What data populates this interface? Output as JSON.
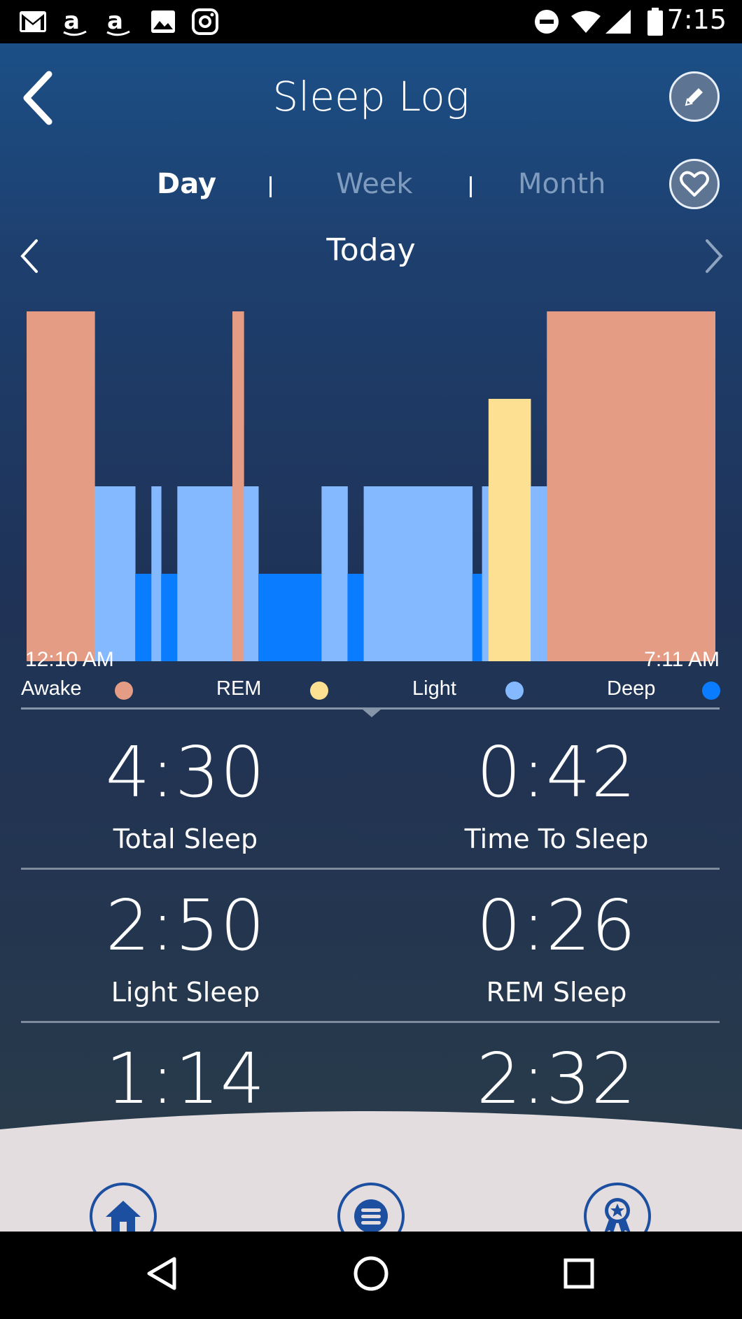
{
  "status_bar": {
    "time": "7:15",
    "left_icons": [
      "gmail-icon",
      "amazon-icon",
      "amazon-icon",
      "photo-icon",
      "instagram-icon"
    ],
    "right_icons": [
      "do-not-disturb-icon",
      "wifi-icon",
      "signal-icon",
      "battery-icon"
    ]
  },
  "header": {
    "title": "Sleep Log",
    "back_icon": "chevron-left-icon",
    "edit_icon": "pencil-icon",
    "favorite_icon": "heart-icon"
  },
  "tabs": [
    {
      "label": "Day",
      "active": true
    },
    {
      "label": "Week",
      "active": false
    },
    {
      "label": "Month",
      "active": false
    }
  ],
  "date_nav": {
    "label": "Today",
    "prev_icon": "chevron-left-icon",
    "next_icon": "chevron-right-icon"
  },
  "chart_data": {
    "type": "bar",
    "start_time": "12:10 AM",
    "end_time": "7:11 AM",
    "levels": [
      "Deep",
      "Light",
      "REM",
      "Awake"
    ],
    "colors": {
      "Awake": "#e59c84",
      "REM": "#fde092",
      "Light": "#85b9ff",
      "Deep": "#0a7cff"
    },
    "segments": [
      {
        "stage": "Awake",
        "minutes": 42
      },
      {
        "stage": "Light",
        "minutes": 25
      },
      {
        "stage": "Deep",
        "minutes": 10
      },
      {
        "stage": "Light",
        "minutes": 6
      },
      {
        "stage": "Deep",
        "minutes": 10
      },
      {
        "stage": "Light",
        "minutes": 34
      },
      {
        "stage": "Awake",
        "minutes": 7
      },
      {
        "stage": "Light",
        "minutes": 9
      },
      {
        "stage": "Deep",
        "minutes": 39
      },
      {
        "stage": "Light",
        "minutes": 16
      },
      {
        "stage": "Deep",
        "minutes": 10
      },
      {
        "stage": "Light",
        "minutes": 67
      },
      {
        "stage": "Deep",
        "minutes": 6
      },
      {
        "stage": "Light",
        "minutes": 4
      },
      {
        "stage": "REM",
        "minutes": 26
      },
      {
        "stage": "Light",
        "minutes": 10
      },
      {
        "stage": "Awake",
        "minutes": 104
      }
    ]
  },
  "legend": [
    {
      "label": "Awake",
      "color": "#e59c84"
    },
    {
      "label": "REM",
      "color": "#fde092"
    },
    {
      "label": "Light",
      "color": "#85b9ff"
    },
    {
      "label": "Deep",
      "color": "#0a7cff"
    }
  ],
  "stats": [
    {
      "value": "4:30",
      "label": "Total Sleep"
    },
    {
      "value": "0:42",
      "label": "Time To Sleep"
    },
    {
      "value": "2:50",
      "label": "Light Sleep"
    },
    {
      "value": "0:26",
      "label": "REM Sleep"
    },
    {
      "value": "1:14",
      "label": ""
    },
    {
      "value": "2:32",
      "label": ""
    }
  ],
  "bottom_nav": [
    {
      "icon": "home-icon"
    },
    {
      "icon": "menu-icon"
    },
    {
      "icon": "award-ribbon-icon"
    }
  ],
  "system_nav": [
    "back-triangle-icon",
    "home-circle-icon",
    "recents-square-icon"
  ]
}
